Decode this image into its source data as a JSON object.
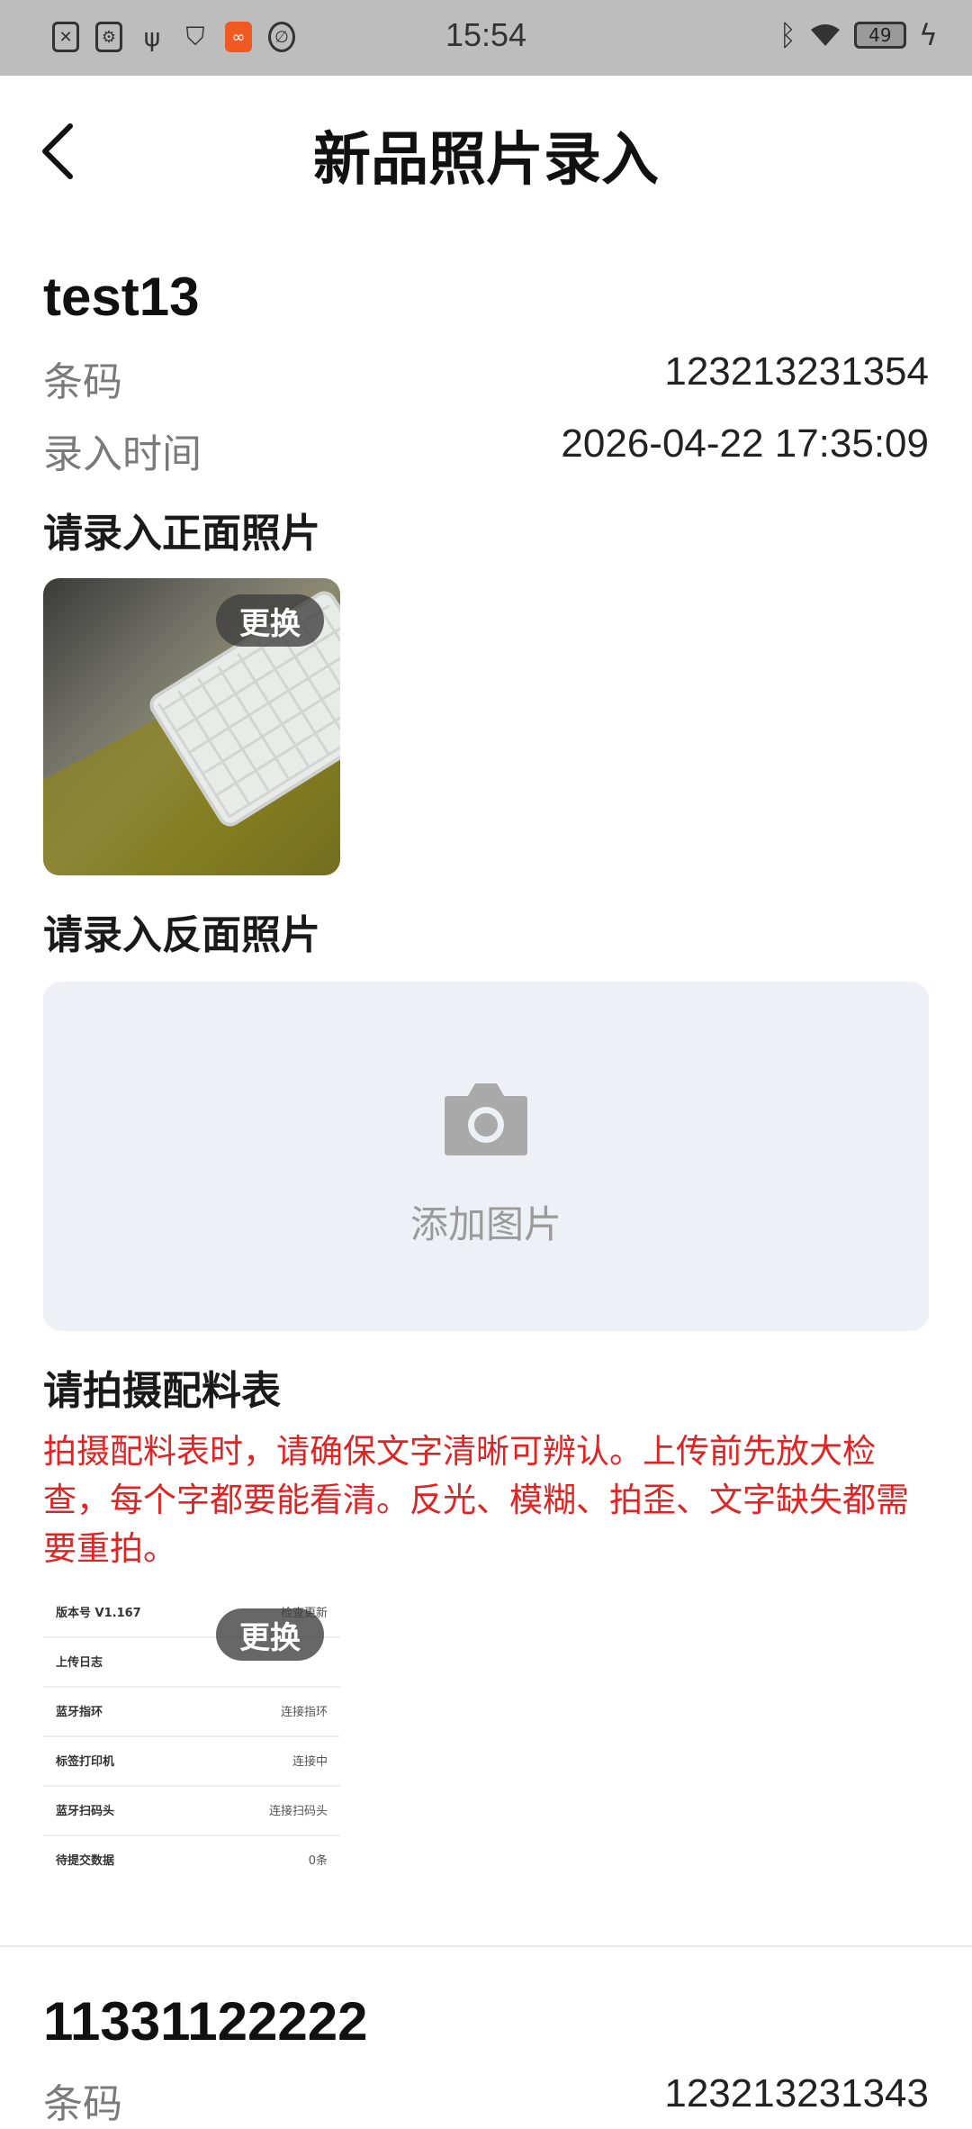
{
  "status_bar": {
    "time": "15:54",
    "battery": "49"
  },
  "header": {
    "title": "新品照片录入"
  },
  "products": [
    {
      "name": "test13",
      "barcode_label": "条码",
      "barcode": "123213231354",
      "entry_time_label": "录入时间",
      "entry_time": "2026-04-22 17:35:09",
      "front_photo_title": "请录入正面照片",
      "replace_label": "更换",
      "back_photo_title": "请录入反面照片",
      "add_photo_label": "添加图片",
      "bom_title": "请拍摄配料表",
      "bom_warning": "拍摄配料表时，请确保文字清晰可辨认。上传前先放大检查，每个字都要能看清。反光、模糊、拍歪、文字缺失都需要重拍。",
      "bom_replace_label": "更换",
      "bom_preview": [
        {
          "label": "版本号  V1.167",
          "value": "检查更新"
        },
        {
          "label": "上传日志",
          "value": ""
        },
        {
          "label": "蓝牙指环",
          "value": "连接指环"
        },
        {
          "label": "标签打印机",
          "value": "连接中"
        },
        {
          "label": "蓝牙扫码头",
          "value": "连接扫码头"
        },
        {
          "label": "待提交数据",
          "value": "0条"
        }
      ]
    },
    {
      "name": "11331122222",
      "barcode_label": "条码",
      "barcode": "123213231343"
    }
  ],
  "colors": {
    "warning": "#e02424",
    "status_bar": "#bdbdbd",
    "add_photo_bg": "#edf0f4"
  }
}
